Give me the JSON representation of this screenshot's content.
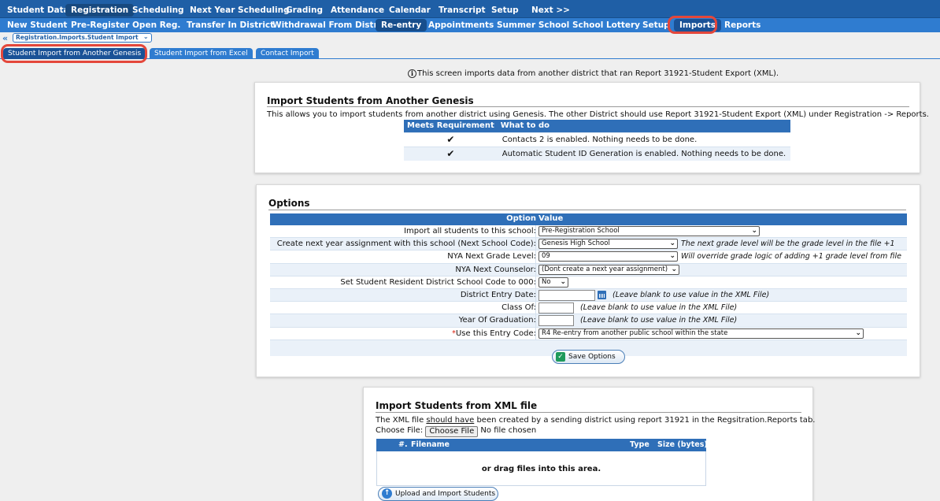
{
  "nav_primary": [
    {
      "label": "Student Data"
    },
    {
      "label": "Registration"
    },
    {
      "label": "Scheduling"
    },
    {
      "label": "Next Year Scheduling"
    },
    {
      "label": "Grading"
    },
    {
      "label": "Attendance"
    },
    {
      "label": "Calendar"
    },
    {
      "label": "Transcript"
    },
    {
      "label": "Setup"
    },
    {
      "label": "Next >>"
    }
  ],
  "nav_secondary": [
    {
      "label": "New Student"
    },
    {
      "label": "Pre-Register"
    },
    {
      "label": "Open Reg."
    },
    {
      "label": "Transfer In District"
    },
    {
      "label": "Withdrawal From District"
    },
    {
      "label": "Re-entry"
    },
    {
      "label": "Appointments"
    },
    {
      "label": "Summer School"
    },
    {
      "label": "School Lottery"
    },
    {
      "label": "Setup"
    },
    {
      "label": "Imports"
    },
    {
      "label": "Reports"
    }
  ],
  "breadcrumb": {
    "back": "«",
    "selected": "Registration.Imports.Student Import"
  },
  "subtabs": [
    {
      "label": "Student Import from Another Genesis"
    },
    {
      "label": "Student Import from Excel"
    },
    {
      "label": "Contact Import"
    }
  ],
  "info_text": "This screen imports data from another district that ran Report 31921-Student Export (XML).",
  "import_genesis": {
    "title": "Import Students from Another Genesis",
    "description": "This allows you to import students from another district using Genesis. The other District should use Report 31921-Student Export (XML) under Registration -> Reports.",
    "headers": [
      "Meets Requirement",
      "What to do"
    ],
    "rows": [
      {
        "check": "✔",
        "text": "Contacts 2 is enabled. Nothing needs to be done."
      },
      {
        "check": "✔",
        "text": "Automatic Student ID Generation is enabled. Nothing needs to be done."
      }
    ]
  },
  "options": {
    "title": "Options",
    "headers": [
      "Option",
      "Value"
    ],
    "rows": [
      {
        "label": "Import all students to this school:",
        "value": "Pre-Registration School",
        "hint": ""
      },
      {
        "label": "Create next year assignment with this school (Next School Code):",
        "value": "Genesis High School",
        "hint": "The next grade level will be the grade level in the file +1"
      },
      {
        "label": "NYA Next Grade Level:",
        "value": "09",
        "hint": "Will override grade logic of adding +1 grade level from file"
      },
      {
        "label": "NYA Next Counselor:",
        "value": "(Dont create a next year assignment)",
        "hint": ""
      },
      {
        "label": "Set Student Resident District School Code to 000:",
        "value": "No",
        "hint": ""
      },
      {
        "label": "District Entry Date:",
        "value": "",
        "hint": "(Leave blank to use value in the XML File)"
      },
      {
        "label": "Class Of:",
        "value": "",
        "hint": "(Leave blank to use value in the XML File)"
      },
      {
        "label": "Year Of Graduation:",
        "value": "",
        "hint": "(Leave blank to use value in the XML File)"
      },
      {
        "label": "Use this Entry Code:",
        "required": "*",
        "value": "R4 Re-entry from another public school within the state",
        "hint": ""
      }
    ],
    "save_label": "Save Options"
  },
  "xml_import": {
    "title": "Import Students from XML file",
    "description_pre": "The XML file ",
    "description_u": "should have",
    "description_post": " been created by a sending district using report 31921 in the Regsitration.Reports tab.",
    "choose_label": "Choose File:",
    "choose_button": "Choose File",
    "no_file": "No file chosen",
    "headers": {
      "num": "#.",
      "filename": "Filename",
      "type": "Type",
      "size": "Size (bytes)"
    },
    "drop_text": "or drag files into this area.",
    "upload_label": "Upload and Import Students"
  },
  "colors": {
    "nav_dark": "#1f5fa6",
    "nav_light": "#2f7cd0",
    "highlight": "#e4473b",
    "table_header": "#2f6fb8"
  }
}
